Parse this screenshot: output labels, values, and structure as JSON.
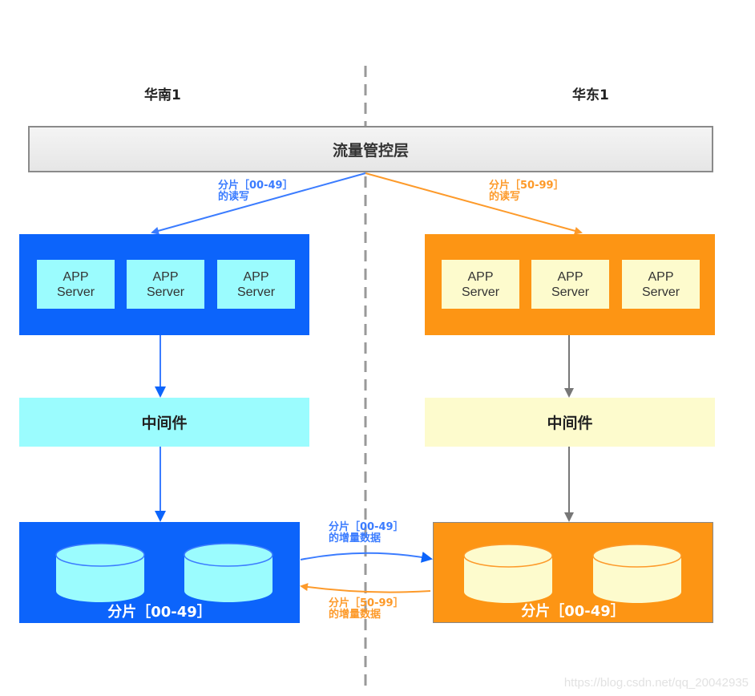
{
  "regions": {
    "left": {
      "title": "华南1"
    },
    "right": {
      "title": "华东1"
    }
  },
  "traffic_layer": {
    "label": "流量管控层"
  },
  "routing_labels": {
    "left": {
      "line1": "分片［00-49］",
      "line2": "的读写"
    },
    "right": {
      "line1": "分片［50-99］",
      "line2": "的读写"
    }
  },
  "app_clusters": {
    "left": {
      "servers": [
        {
          "line1": "APP",
          "line2": "Server"
        },
        {
          "line1": "APP",
          "line2": "Server"
        },
        {
          "line1": "APP",
          "line2": "Server"
        }
      ]
    },
    "right": {
      "servers": [
        {
          "line1": "APP",
          "line2": "Server"
        },
        {
          "line1": "APP",
          "line2": "Server"
        },
        {
          "line1": "APP",
          "line2": "Server"
        }
      ]
    }
  },
  "middleware": {
    "left": {
      "label": "中间件"
    },
    "right": {
      "label": "中间件"
    }
  },
  "shards": {
    "left": {
      "label": "分片［00-49］"
    },
    "right": {
      "label": "分片［00-49］"
    }
  },
  "sync_labels": {
    "to_right": {
      "line1": "分片［00-49］",
      "line2": "的增量数据"
    },
    "to_left": {
      "line1": "分片［50-99］",
      "line2": "的增量数据"
    }
  },
  "colors": {
    "blue": "#0c64fb",
    "light_cyan": "#9bfcfe",
    "orange": "#fd9514",
    "light_yellow": "#fdfbcd",
    "gray_arrow": "#777777"
  },
  "watermark": "https://blog.csdn.net/qq_20042935"
}
